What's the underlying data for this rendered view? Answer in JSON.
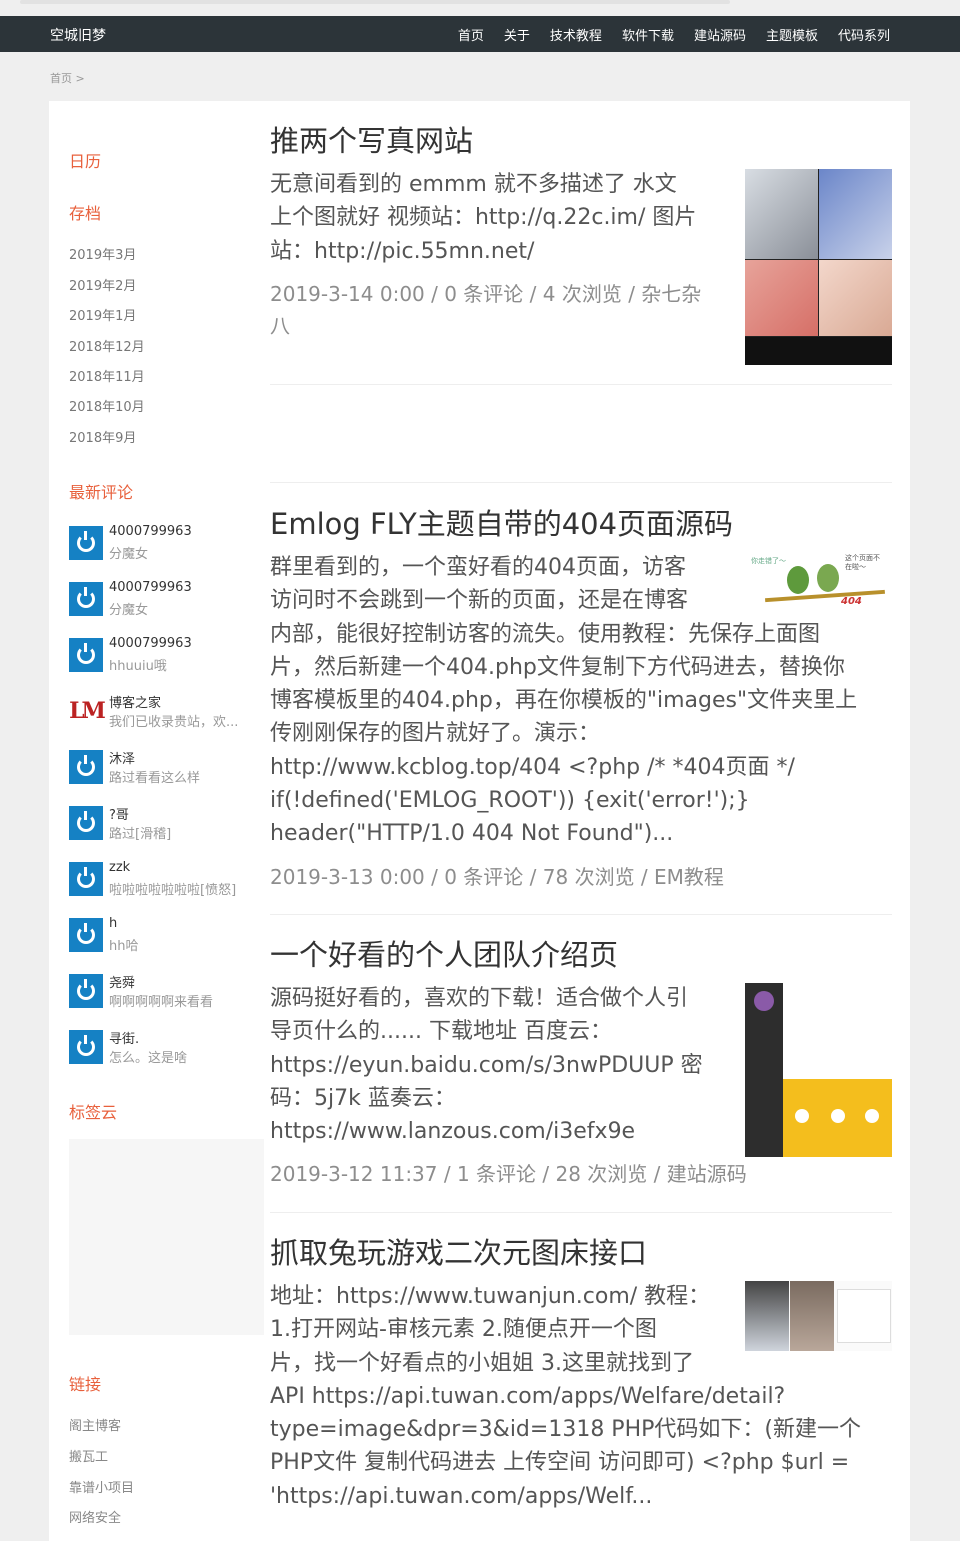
{
  "site": {
    "title": "空城旧梦",
    "menu": [
      "首页",
      "关于",
      "技术教程",
      "软件下载",
      "建站源码",
      "主题模板",
      "代码系列"
    ]
  },
  "breadcrumb": "首页 >",
  "sidebar": {
    "calendar_title": "日历",
    "archive_title": "存档",
    "archives": [
      "2019年3月",
      "2019年2月",
      "2019年1月",
      "2018年12月",
      "2018年11月",
      "2018年10月",
      "2018年9月"
    ],
    "comments_title": "最新评论",
    "comments": [
      {
        "name": "4000799963",
        "text": "分魔女",
        "avatar": "qq-icon"
      },
      {
        "name": "4000799963",
        "text": "分魔女",
        "avatar": "qq-icon"
      },
      {
        "name": "4000799963",
        "text": "hhuuiu哦",
        "avatar": "qq-icon"
      },
      {
        "name": "博客之家",
        "text": "我们已收录贵站，欢...",
        "avatar": "lm-logo"
      },
      {
        "name": "沐泽",
        "text": "路过看看这么样",
        "avatar": "qq-icon"
      },
      {
        "name": "?哥",
        "text": "路过[滑稽]",
        "avatar": "qq-icon"
      },
      {
        "name": "zzk",
        "text": "啦啦啦啦啦啦啦[愤怒]",
        "avatar": "qq-icon"
      },
      {
        "name": "h",
        "text": "hh哈",
        "avatar": "qq-icon"
      },
      {
        "name": "尧舜",
        "text": "啊啊啊啊啊来看看",
        "avatar": "qq-icon"
      },
      {
        "name": "寻街.",
        "text": "怎么。这是啥",
        "avatar": "qq-icon"
      }
    ],
    "tags_title": "标签云",
    "links_title": "链接",
    "links": [
      "阁主博客",
      "搬瓦工",
      "靠谱小项目",
      "网络安全"
    ]
  },
  "posts": [
    {
      "title": "推两个写真网站",
      "body": [
        "无意间看到的 emmm 就不多描述了 水文",
        "上个图就好 视频站：http://q.22c.im/ 图片",
        "站：http://pic.55mn.net/"
      ],
      "meta": [
        "2019-3-14 0:00 /  0 条评论 /  4 次浏览 /  杂七杂",
        "八"
      ]
    },
    {
      "title": "Emlog FLY主题自带的404页面源码",
      "body": [
        "群里看到的，一个蛮好看的404页面，访客",
        "访问时不会跳到一个新的页面，还是在博客",
        "内部，能很好控制访客的流失。使用教程：先保存上面图",
        "片，然后新建一个404.php文件复制下方代码进去，替换你",
        "博客模板里的404.php，再在你模板的\"images\"文件夹里上",
        "传刚刚保存的图片就好了。演示：",
        "http://www.kcblog.top/404 <?php /* *404页面 */",
        "if(!defined('EMLOG_ROOT')) {exit('error!');}",
        "header(\"HTTP/1.0 404 Not Found\")..."
      ],
      "meta": [
        "2019-3-13 0:00 /  0 条评论 /  78 次浏览 /  EM教程"
      ],
      "image_text_left": "你走错了～",
      "image_text_right": "这个页面不在啦～",
      "image_badge": "404"
    },
    {
      "title": "一个好看的个人团队介绍页",
      "body": [
        "源码挺好看的，喜欢的下载！适合做个人引",
        "导页什么的...... 下载地址 百度云：",
        "https://eyun.baidu.com/s/3nwPDUUP   密",
        "码：5j7k 蓝奏云：",
        "https://www.lanzous.com/i3efx9e"
      ],
      "meta": [
        "2019-3-12 11:37 /  1 条评论 /  28 次浏览 /  建站源码"
      ]
    },
    {
      "title": "抓取兔玩游戏二次元图床接口",
      "body": [
        "地址：https://www.tuwanjun.com/ 教程：",
        "1.打开网站-审核元素 2.随便点开一个图",
        "片，找一个好看点的小姐姐 3.这里就找到了",
        "API  https://api.tuwan.com/apps/Welfare/detail?",
        "type=image&dpr=3&id=1318 PHP代码如下：(新建一个",
        "PHP文件 复制代码进去 上传空间 访问即可) <?php $url =",
        "'https://api.tuwan.com/apps/Welf..."
      ]
    }
  ]
}
